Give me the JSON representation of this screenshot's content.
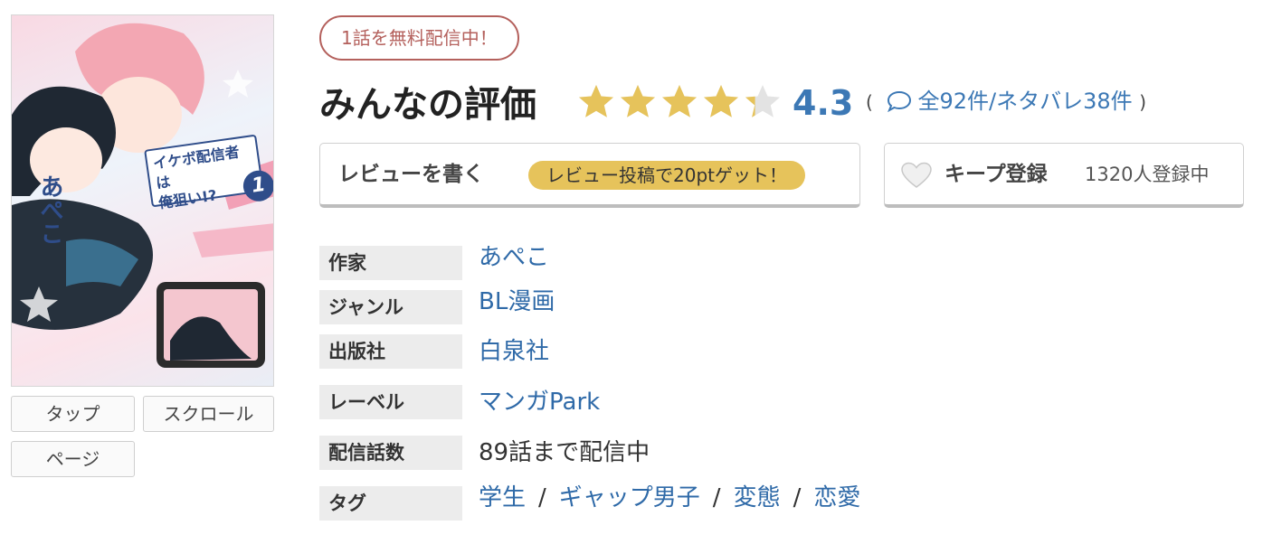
{
  "cover": {
    "title_line1": "イケボ配信者は",
    "title_line2": "俺狙い!?",
    "volume": "1",
    "author_text": "あぺこ"
  },
  "reader_buttons": [
    "タップ",
    "スクロール",
    "ページ"
  ],
  "free_badge": "1話を無料配信中！",
  "rating": {
    "title": "みんなの評価",
    "score": "4.3",
    "score_value": 4.3,
    "max_stars": 5,
    "open_paren": "(",
    "close_paren": ")",
    "review_count": "全92件",
    "separator": "/",
    "spoiler_count": "ネタバレ38件"
  },
  "actions": {
    "review_label": "レビューを書く",
    "review_bonus": "レビュー投稿で20ptゲット！",
    "keep_label": "キープ登録",
    "keep_count": "1320人登録中"
  },
  "info": {
    "author_label": "作家",
    "author": "あぺこ",
    "genre_label": "ジャンル",
    "genre": "BL漫画",
    "publisher_label": "出版社",
    "publisher": "白泉社",
    "label_label": "レーベル",
    "label": "マンガPark",
    "episodes_label": "配信話数",
    "episodes": "89話まで配信中",
    "tags_label": "タグ",
    "tags": [
      "学生",
      "ギャップ男子",
      "変態",
      "恋愛"
    ],
    "tag_separator": "/"
  },
  "colors": {
    "link": "#3c78b5",
    "star": "#e6c35b",
    "badge_border": "#b4605c",
    "pt_badge": "#e6c35b"
  }
}
